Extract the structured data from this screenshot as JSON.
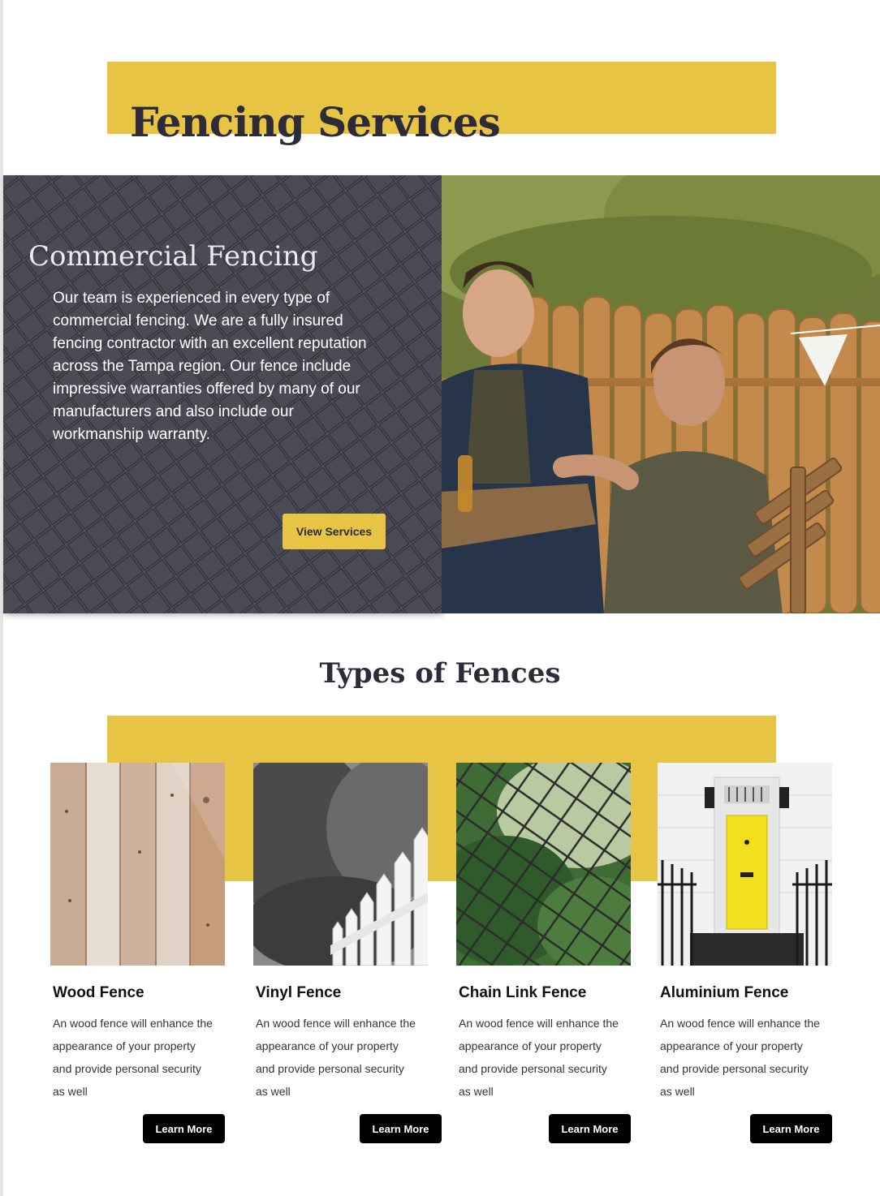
{
  "colors": {
    "accent": "#e8c444",
    "panel": "#4a4b55",
    "dark_text": "#2b2c38",
    "button_dark": "#000000"
  },
  "hero": {
    "title": "Fencing Services"
  },
  "commercial": {
    "title": "Commercial Fencing",
    "body": "Our team is experienced in every type of commercial fencing. We are a fully insured fencing contractor with an excellent reputation across the Tampa region. Our fence include impressive warranties offered by many of our manufacturers and also include our workmanship warranty.",
    "button_label": "View Services"
  },
  "types": {
    "title": "Types of Fences",
    "cards": [
      {
        "title": "Wood Fence",
        "description": "An wood fence will enhance the appearance of your property and provide personal security as well",
        "button_label": "Learn More"
      },
      {
        "title": "Vinyl Fence",
        "description": "An wood fence will enhance the appearance of your property and provide personal security as well",
        "button_label": "Learn More"
      },
      {
        "title": "Chain Link Fence",
        "description": "An wood fence will enhance the appearance of your property and provide personal security as well",
        "button_label": "Learn More"
      },
      {
        "title": "Aluminium Fence",
        "description": "An wood fence will enhance the appearance of your property and provide personal security as well",
        "button_label": "Learn More"
      }
    ]
  }
}
